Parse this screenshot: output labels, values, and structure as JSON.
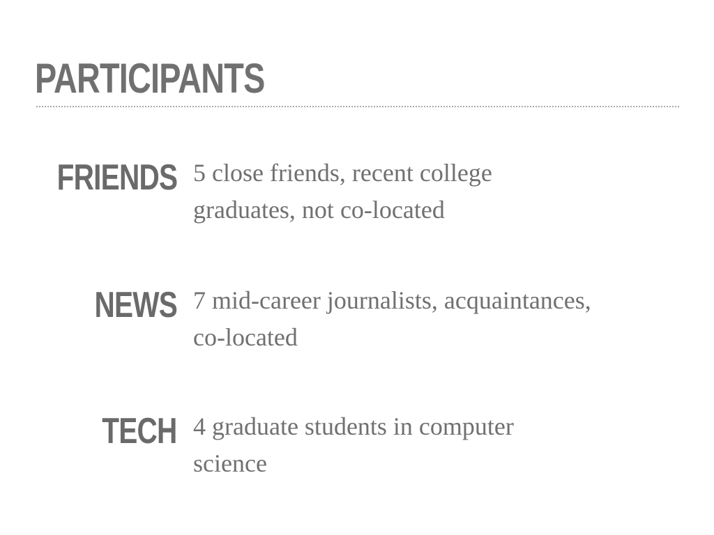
{
  "slide": {
    "title": "PARTICIPANTS",
    "groups": [
      {
        "label": "FRIENDS",
        "description_line1": "5 close friends, recent college",
        "description_line2": "graduates, not co-located"
      },
      {
        "label": "NEWS",
        "description_line1": "7 mid-career journalists, acquaintances,",
        "description_line2": "co-located"
      },
      {
        "label": "TECH",
        "description_line1": "4 graduate students in computer",
        "description_line2": "science"
      }
    ]
  },
  "colors": {
    "text": "#707070",
    "rule": "#a8a8a8",
    "background": "#ffffff"
  }
}
